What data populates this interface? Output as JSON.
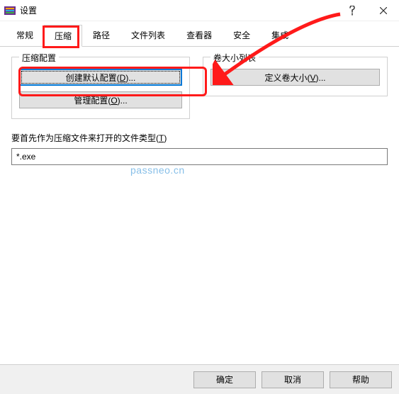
{
  "window": {
    "title": "设置"
  },
  "tabs": {
    "general": "常规",
    "compress": "压缩",
    "path": "路径",
    "filelist": "文件列表",
    "viewer": "查看器",
    "security": "安全",
    "integration": "集成"
  },
  "group_compress": {
    "legend": "压缩配置",
    "create_default": "创建默认配置(",
    "create_default_hotkey": "D",
    "create_default_suffix": ")...",
    "manage": "管理配置(",
    "manage_hotkey": "O",
    "manage_suffix": ")..."
  },
  "group_volume": {
    "legend": "卷大小列表",
    "define": "定义卷大小(",
    "define_hotkey": "V",
    "define_suffix": ")..."
  },
  "filetype": {
    "label_pre": "要首先作为压缩文件来打开的文件类型(",
    "label_hotkey": "T",
    "label_post": ")",
    "value": "*.exe"
  },
  "footer": {
    "ok": "确定",
    "cancel": "取消",
    "help": "帮助"
  },
  "watermark": "passneo.cn"
}
